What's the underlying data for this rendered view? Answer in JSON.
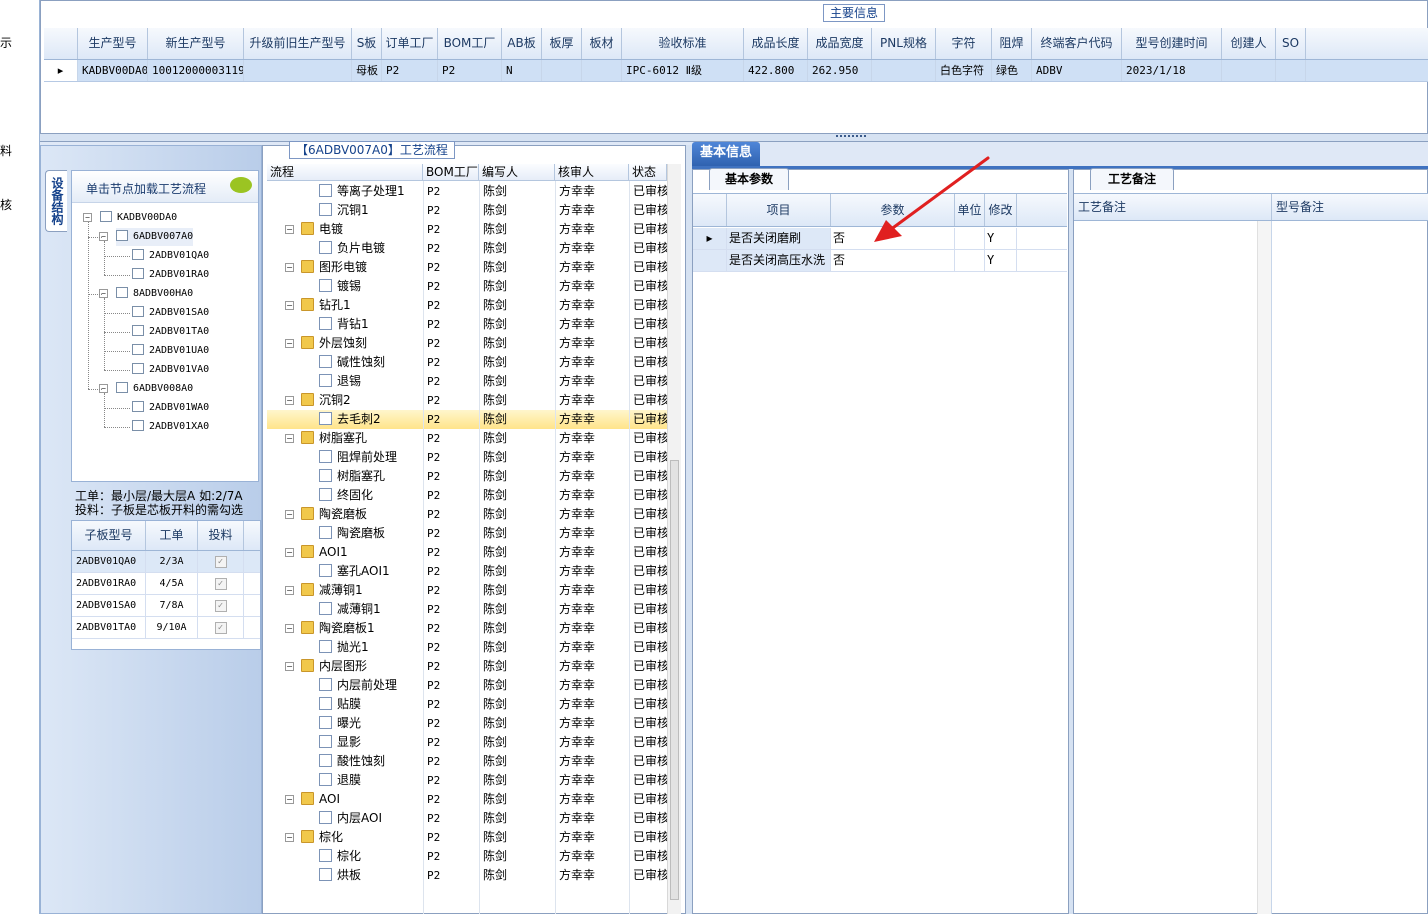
{
  "left_strip": [
    "示",
    "料",
    "核"
  ],
  "main_info": {
    "title": "主要信息",
    "columns": [
      "生产型号",
      "新生产型号",
      "升级前旧生产型号",
      "S板",
      "订单工厂",
      "BOM工厂",
      "AB板",
      "板厚",
      "板材",
      "验收标准",
      "成品长度",
      "成品宽度",
      "PNL规格",
      "字符",
      "阻焊",
      "终端客户代码",
      "型号创建时间",
      "创建人",
      "SO"
    ],
    "row": [
      "KADBV00DA0",
      "10012000003119",
      "",
      "母板",
      "P2",
      "P2",
      "N",
      "",
      "",
      "IPC-6012 Ⅱ级",
      "422.800",
      "262.950",
      "",
      "白色字符",
      "绿色",
      "ADBV",
      "2023/1/18",
      "",
      ""
    ]
  },
  "structure_tab": "设备结构",
  "tree_hint": "单击节点加载工艺流程",
  "tree": {
    "root": "KADBV00DA0",
    "groups": [
      {
        "label": "6ADBV007A0",
        "children": [
          "2ADBV01QA0",
          "2ADBV01RA0"
        ]
      },
      {
        "label": "8ADBV00HA0",
        "children": [
          "2ADBV01SA0",
          "2ADBV01TA0",
          "2ADBV01UA0",
          "2ADBV01VA0"
        ]
      },
      {
        "label": "6ADBV008A0",
        "children": [
          "2ADBV01WA0",
          "2ADBV01XA0"
        ]
      }
    ]
  },
  "work_note": [
    "工单：最小层/最大层A 如:2/7A",
    "投料：子板是芯板开料的需勾选"
  ],
  "sub_grid": {
    "columns": [
      "子板型号",
      "工单",
      "投料"
    ],
    "rows": [
      [
        "2ADBV01QA0",
        "2/3A",
        "✓"
      ],
      [
        "2ADBV01RA0",
        "4/5A",
        "✓"
      ],
      [
        "2ADBV01SA0",
        "7/8A",
        "✓"
      ],
      [
        "2ADBV01TA0",
        "9/10A",
        "✓"
      ]
    ]
  },
  "process": {
    "title": "【6ADBV007A0】工艺流程",
    "columns": [
      "流程",
      "BOM工厂",
      "编写人",
      "核审人",
      "状态"
    ],
    "factory": "P2",
    "writer": "陈剑",
    "reviewer": "方幸幸",
    "status": "已审核",
    "rows": [
      {
        "name": "等离子处理1",
        "level": 1
      },
      {
        "name": "沉铜1",
        "level": 1
      },
      {
        "name": "电镀",
        "level": 0
      },
      {
        "name": "负片电镀",
        "level": 1
      },
      {
        "name": "图形电镀",
        "level": 0
      },
      {
        "name": "镀锡",
        "level": 1
      },
      {
        "name": "钻孔1",
        "level": 0
      },
      {
        "name": "背钻1",
        "level": 1
      },
      {
        "name": "外层蚀刻",
        "level": 0
      },
      {
        "name": "碱性蚀刻",
        "level": 1
      },
      {
        "name": "退锡",
        "level": 1
      },
      {
        "name": "沉铜2",
        "level": 0
      },
      {
        "name": "去毛刺2",
        "level": 1,
        "selected": true
      },
      {
        "name": "树脂塞孔",
        "level": 0
      },
      {
        "name": "阻焊前处理",
        "level": 1
      },
      {
        "name": "树脂塞孔",
        "level": 1
      },
      {
        "name": "终固化",
        "level": 1
      },
      {
        "name": "陶瓷磨板",
        "level": 0
      },
      {
        "name": "陶瓷磨板",
        "level": 1
      },
      {
        "name": "AOI1",
        "level": 0
      },
      {
        "name": "塞孔AOI1",
        "level": 1
      },
      {
        "name": "减薄铜1",
        "level": 0
      },
      {
        "name": "减薄铜1",
        "level": 1
      },
      {
        "name": "陶瓷磨板1",
        "level": 0
      },
      {
        "name": "抛光1",
        "level": 1
      },
      {
        "name": "内层图形",
        "level": 0
      },
      {
        "name": "内层前处理",
        "level": 1
      },
      {
        "name": "贴膜",
        "level": 1
      },
      {
        "name": "曝光",
        "level": 1
      },
      {
        "name": "显影",
        "level": 1
      },
      {
        "name": "酸性蚀刻",
        "level": 1
      },
      {
        "name": "退膜",
        "level": 1
      },
      {
        "name": "AOI",
        "level": 0
      },
      {
        "name": "内层AOI",
        "level": 1
      },
      {
        "name": "棕化",
        "level": 0
      },
      {
        "name": "棕化",
        "level": 1
      },
      {
        "name": "烘板",
        "level": 1
      }
    ]
  },
  "info": {
    "tab": "基本信息",
    "basic_tab": "基本参数",
    "columns": [
      "项目",
      "参数",
      "单位",
      "修改"
    ],
    "rows": [
      [
        "是否关闭磨刷",
        "否",
        "",
        "Y"
      ],
      [
        "是否关闭高压水洗",
        "否",
        "",
        "Y"
      ]
    ],
    "remark_tab": "工艺备注",
    "remark_columns": [
      "工艺备注",
      "型号备注"
    ]
  },
  "colors": {
    "accent": "#2f62b0",
    "arrow": "#e02020",
    "selected_row": "#ffe48a"
  }
}
